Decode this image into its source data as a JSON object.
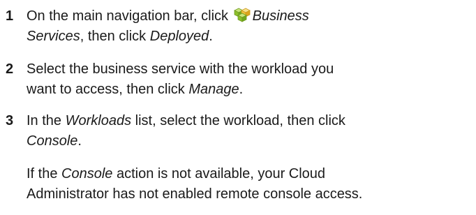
{
  "steps": [
    {
      "number": "1",
      "line1_pre": "On the main navigation bar, click ",
      "line1_em": "Business",
      "line2_em": "Services",
      "line2_mid": ", then click ",
      "line2_em2": "Deployed",
      "line2_post": ".",
      "icon": "business-services-icon"
    },
    {
      "number": "2",
      "line1": "Select the business service with the workload you",
      "line2_pre": "want to access, then click ",
      "line2_em": "Manage",
      "line2_post": "."
    },
    {
      "number": "3",
      "line1_pre": "In the ",
      "line1_em": "Workloads",
      "line1_post": " list, select the workload, then click",
      "line2_em": "Console",
      "line2_post": "."
    }
  ],
  "note": {
    "line1_pre": "If the ",
    "line1_em": "Console",
    "line1_post": " action is not available, your Cloud",
    "line2": "Administrator has not enabled remote console access."
  },
  "colors": {
    "text": "#1a1a1a",
    "icon_green": "#9ccc3a",
    "icon_yellow": "#f2c23a"
  }
}
